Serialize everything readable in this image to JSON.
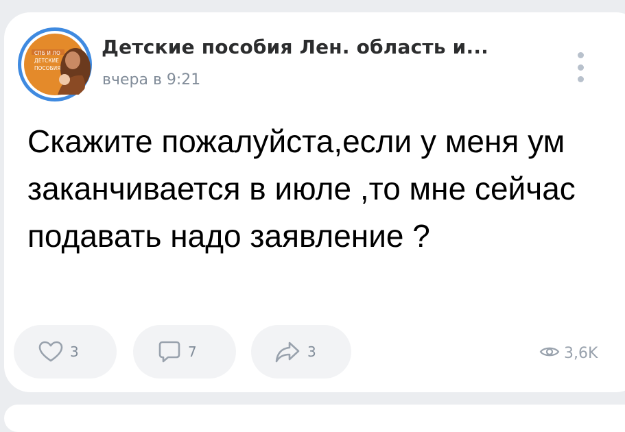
{
  "post": {
    "author": {
      "name": "Детские  пособия Лен. область и...",
      "avatar_text": [
        "СПБ И ЛО",
        "ДЕТСКИЕ",
        "ПОСОБИЯ"
      ]
    },
    "time": "вчера в 9:21",
    "text": "Скажите пожалуйста,если у меня ум заканчивается в июле ,то мне сейчас подавать надо заявление ?",
    "actions": {
      "likes": "3",
      "comments": "7",
      "shares": "3"
    },
    "views": "3,6K"
  },
  "colors": {
    "background": "#ebedf0",
    "card": "#ffffff",
    "button_bg": "#f2f3f5",
    "icon_gray": "#99a2ad",
    "secondary_text": "#818c99",
    "avatar_ring": "#3f8ae0",
    "avatar_bg": "#e48a2a"
  },
  "icons": [
    "heart-outline-icon",
    "comment-icon",
    "share-arrow-icon",
    "eye-icon",
    "more-vertical-icon"
  ]
}
